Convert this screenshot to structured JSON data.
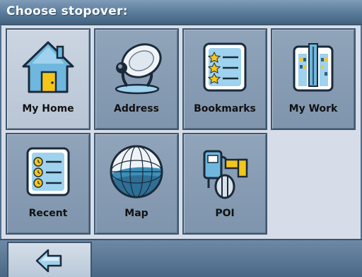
{
  "header": {
    "title": "Choose stopover:"
  },
  "tiles": [
    {
      "label": "My Home",
      "icon": "house-icon"
    },
    {
      "label": "Address",
      "icon": "satellite-dish-icon"
    },
    {
      "label": "Bookmarks",
      "icon": "bookmarks-list-icon"
    },
    {
      "label": "My Work",
      "icon": "office-building-icon"
    },
    {
      "label": "Recent",
      "icon": "recent-list-icon"
    },
    {
      "label": "Map",
      "icon": "globe-map-icon"
    },
    {
      "label": "POI",
      "icon": "gas-pump-icon"
    }
  ],
  "footer": {
    "back_icon": "back-arrow-icon"
  },
  "colors": {
    "title_bar": "#5a7a9b",
    "tile": "#8aa0b8",
    "tile_selected": "#c3cedc",
    "background": "#d7dde8"
  }
}
